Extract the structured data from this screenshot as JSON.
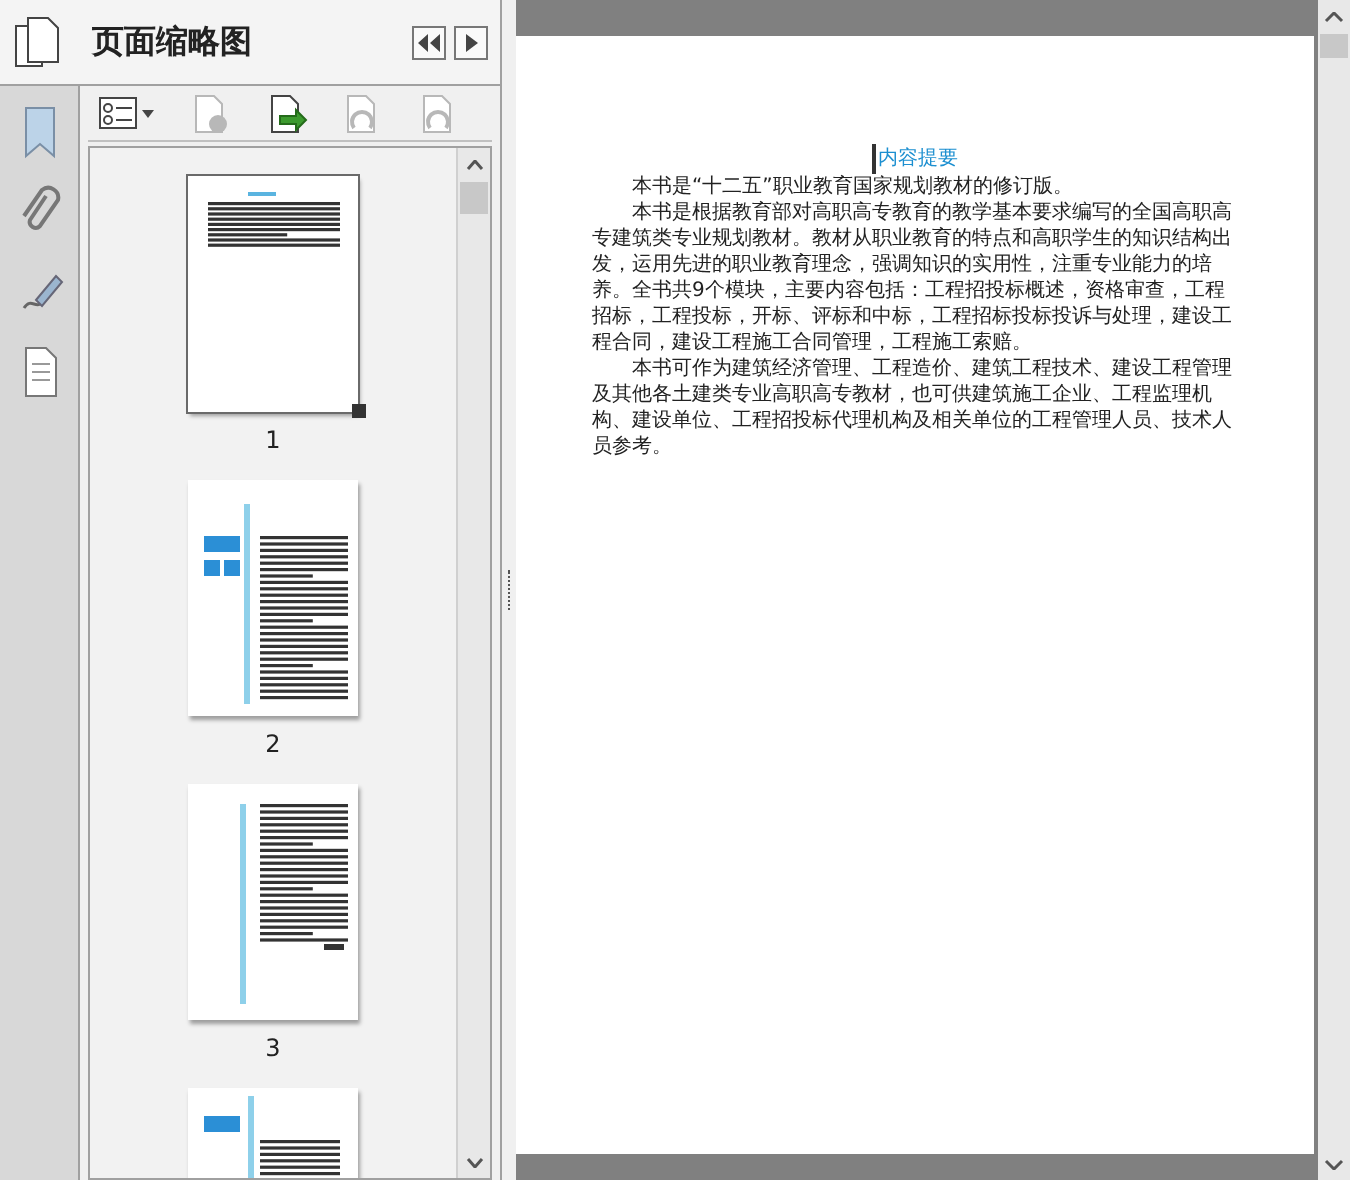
{
  "panel": {
    "title": "页面缩略图"
  },
  "toolbar": [
    {
      "kind": "options",
      "disabled": false
    },
    {
      "kind": "delete",
      "disabled": true
    },
    {
      "kind": "insert",
      "disabled": false
    },
    {
      "kind": "rotate-left",
      "disabled": true
    },
    {
      "kind": "rotate-right",
      "disabled": true
    }
  ],
  "sidebar": [
    {
      "kind": "bookmark"
    },
    {
      "kind": "attachment"
    },
    {
      "kind": "signature"
    },
    {
      "kind": "document"
    }
  ],
  "thumbnails": [
    {
      "kind": "summary",
      "label": "1",
      "selected": true
    },
    {
      "kind": "chapter",
      "label": "2",
      "selected": false
    },
    {
      "kind": "text",
      "label": "3",
      "selected": false
    },
    {
      "kind": "contents",
      "selected": false
    }
  ],
  "document": {
    "heading": "内容提要",
    "paragraphs": [
      "本书是“十二五”职业教育国家规划教材的修订版。",
      "本书是根据教育部对高职高专教育的教学基本要求编写的全国高职高专建筑类专业规划教材。教材从职业教育的特点和高职学生的知识结构出发，运用先进的职业教育理念，强调知识的实用性，注重专业能力的培养。全书共9个模块，主要内容包括：工程招投标概述，资格审查，工程招标，工程投标，开标、评标和中标，工程招标投标投诉与处理，建设工程合同，建设工程施工合同管理，工程施工索赔。",
      "本书可作为建筑经济管理、工程造价、建筑工程技术、建设工程管理及其他各土建类专业高职高专教材，也可供建筑施工企业、工程监理机构、建设单位、工程招投标代理机构及相关单位的工程管理人员、技术人员参考。"
    ]
  }
}
